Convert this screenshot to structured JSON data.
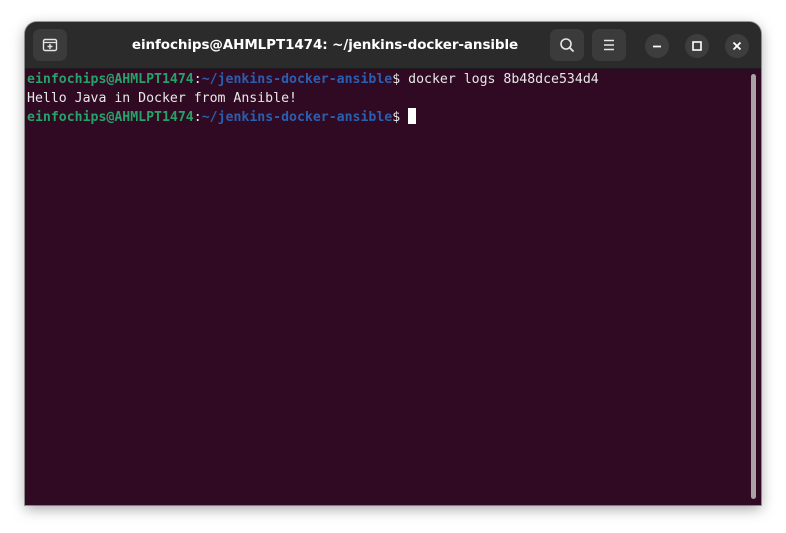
{
  "window": {
    "title": "einfochips@AHMLPT1474: ~/jenkins-docker-ansible"
  },
  "titlebar": {
    "icons": {
      "new_tab": "new-tab-icon",
      "search": "search-icon",
      "menu": "hamburger-menu-icon",
      "minimize": "minimize-icon",
      "maximize": "maximize-icon",
      "close": "close-icon"
    }
  },
  "terminal": {
    "lines": [
      {
        "user_host": "einfochips@AHMLPT1474",
        "colon": ":",
        "path": "~/jenkins-docker-ansible",
        "prompt": "$",
        "command": " docker logs 8b48dce534d4"
      },
      {
        "output": "Hello Java in Docker from Ansible!"
      },
      {
        "user_host": "einfochips@AHMLPT1474",
        "colon": ":",
        "path": "~/jenkins-docker-ansible",
        "prompt": "$",
        "command": " "
      }
    ]
  },
  "colors": {
    "terminal_background": "#2f0a22",
    "user_host": "#26a269",
    "path": "#2a5fb0",
    "text": "#e8e8e8",
    "titlebar": "#2b2b2b"
  }
}
